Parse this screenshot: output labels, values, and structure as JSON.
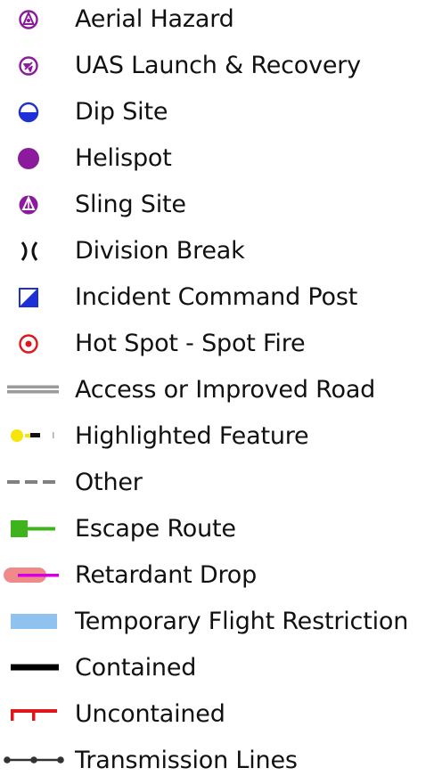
{
  "legend": {
    "items": [
      {
        "label": "Aerial Hazard",
        "icon": "aerial-hazard-icon",
        "color": "#8b1a9c"
      },
      {
        "label": "UAS Launch & Recovery",
        "icon": "uas-launch-recovery-icon",
        "color": "#8b1a9c"
      },
      {
        "label": "Dip Site",
        "icon": "dip-site-icon",
        "color": "#1f2fd6"
      },
      {
        "label": "Helispot",
        "icon": "helispot-icon",
        "color": "#8b1a9c"
      },
      {
        "label": "Sling Site",
        "icon": "sling-site-icon",
        "color": "#8b1a9c"
      },
      {
        "label": "Division Break",
        "icon": "division-break-icon",
        "color": "#111111"
      },
      {
        "label": "Incident Command Post",
        "icon": "incident-command-post-icon",
        "color": "#1f2fd6"
      },
      {
        "label": "Hot Spot - Spot Fire",
        "icon": "hot-spot-icon",
        "color": "#e0161b"
      },
      {
        "label": "Access or Improved Road",
        "icon": "road-line-icon",
        "color": "#9a9a9a"
      },
      {
        "label": "Highlighted Feature",
        "icon": "highlighted-feature-icon",
        "color": "#f5e50a"
      },
      {
        "label": "Other",
        "icon": "other-dashed-line-icon",
        "color": "#808080"
      },
      {
        "label": "Escape Route",
        "icon": "escape-route-icon",
        "color": "#3db31c"
      },
      {
        "label": "Retardant Drop",
        "icon": "retardant-drop-icon",
        "color": "#d400e0"
      },
      {
        "label": "Temporary Flight Restriction",
        "icon": "tfr-icon",
        "color": "#8fc2ee"
      },
      {
        "label": "Contained",
        "icon": "contained-line-icon",
        "color": "#000000"
      },
      {
        "label": "Uncontained",
        "icon": "uncontained-line-icon",
        "color": "#e0161b"
      },
      {
        "label": "Transmission Lines",
        "icon": "transmission-line-icon",
        "color": "#333333"
      }
    ]
  }
}
